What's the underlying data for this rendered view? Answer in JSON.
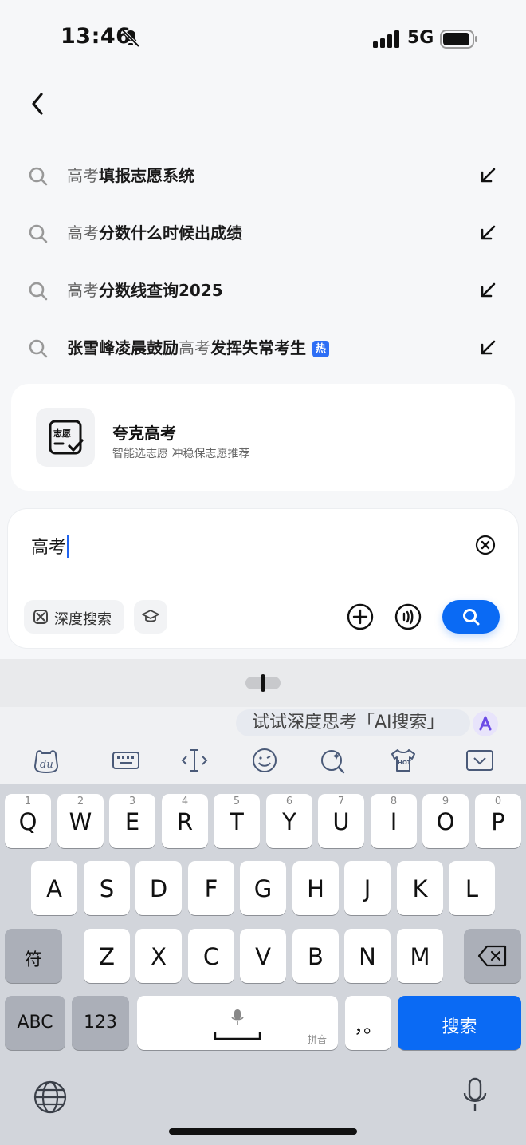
{
  "status": {
    "time": "13:46",
    "network": "5G"
  },
  "suggestions": [
    {
      "highlight": "高考",
      "rest": "填报志愿系统",
      "hot": false
    },
    {
      "highlight": "高考",
      "rest": "分数什么时候出成绩",
      "hot": false
    },
    {
      "highlight": "高考",
      "rest": "分数线查询2025",
      "hot": false
    },
    {
      "prefix": "张雪峰凌晨鼓励",
      "highlight": "高考",
      "rest": "发挥失常考生",
      "hot": true,
      "hot_label": "热"
    }
  ],
  "app_card": {
    "icon_text": "志愿",
    "title": "夸克高考",
    "subtitle": "智能选志愿 冲稳保志愿推荐"
  },
  "search": {
    "query": "高考",
    "deep_search_label": "深度搜索"
  },
  "keyboard": {
    "ai_tip": "试试深度思考「AI搜索」",
    "toolbar_icons": [
      "du-logo-icon",
      "keyboard-icon",
      "cursor-icon",
      "emoji-icon",
      "ai-sparkle-icon",
      "hot-shirt-icon",
      "collapse-keyboard-icon"
    ],
    "hot_icon_text": "HOT",
    "row1": [
      {
        "k": "Q",
        "n": "1"
      },
      {
        "k": "W",
        "n": "2"
      },
      {
        "k": "E",
        "n": "3"
      },
      {
        "k": "R",
        "n": "4"
      },
      {
        "k": "T",
        "n": "5"
      },
      {
        "k": "Y",
        "n": "6"
      },
      {
        "k": "U",
        "n": "7"
      },
      {
        "k": "I",
        "n": "8"
      },
      {
        "k": "O",
        "n": "9"
      },
      {
        "k": "P",
        "n": "0"
      }
    ],
    "row2": [
      "A",
      "S",
      "D",
      "F",
      "G",
      "H",
      "J",
      "K",
      "L"
    ],
    "row3": [
      "Z",
      "X",
      "C",
      "V",
      "B",
      "N",
      "M"
    ],
    "symbol_key": "符",
    "abc_key": "ABC",
    "num_key": "123",
    "space_hint": "拼音",
    "punct_key": "，。",
    "search_key": "搜索"
  },
  "colors": {
    "accent": "#0a6af4",
    "hot_badge": "#2d6ef5"
  }
}
